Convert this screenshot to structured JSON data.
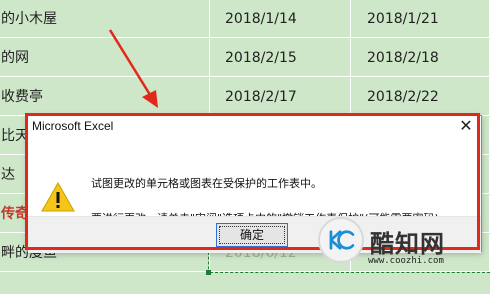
{
  "sheet": {
    "rows": [
      {
        "name": "的小木屋",
        "start": "2018/1/14",
        "end": "2018/1/21"
      },
      {
        "name": "的网",
        "start": "2018/2/15",
        "end": "2018/2/18"
      },
      {
        "name": "收费亭",
        "start": "2018/2/17",
        "end": "2018/2/22"
      },
      {
        "name": "比天",
        "start": "",
        "end": ""
      },
      {
        "name": "达",
        "start": "",
        "end": ""
      },
      {
        "name": "传奇",
        "start": "",
        "end": ""
      },
      {
        "name": "畔的度鱼",
        "start": "2018/6/12",
        "end": ""
      }
    ]
  },
  "dialog": {
    "title": "Microsoft Excel",
    "close": "✕",
    "message1": "试图更改的单元格或图表在受保护的工作表中。",
    "message2": "要进行更改，请单击\"审阅\"选项卡中的\"撤销工作表保护\"(可能需要密码)。",
    "ok_label": "确定"
  },
  "watermark": {
    "logo_text": "酷知网",
    "url": "www.coozhi.com"
  },
  "colors": {
    "sheet_bg": "#cfe7c9",
    "highlight": "#e2271b"
  }
}
